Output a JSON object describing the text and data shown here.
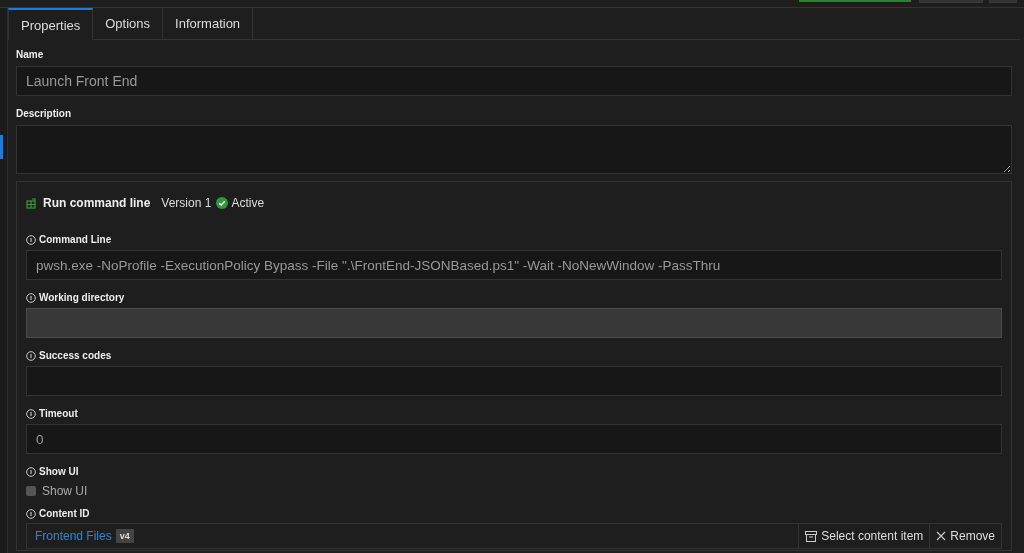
{
  "tabs": [
    {
      "label": "Properties",
      "selected": true
    },
    {
      "label": "Options",
      "selected": false
    },
    {
      "label": "Information",
      "selected": false
    }
  ],
  "name": {
    "label": "Name",
    "value": "Launch Front End"
  },
  "description": {
    "label": "Description"
  },
  "step": {
    "title": "Run command line",
    "version": "Version 1",
    "status": "Active",
    "active": true,
    "fields": [
      {
        "kind": "text",
        "label": "Command Line",
        "value": "pwsh.exe -NoProfile -ExecutionPolicy Bypass -File \".\\FrontEnd-JSONBased.ps1\" -Wait -NoNewWindow -PassThru",
        "disabled": false
      },
      {
        "kind": "text",
        "label": "Working directory",
        "disabled": true
      },
      {
        "kind": "text",
        "label": "Success codes",
        "disabled": false
      },
      {
        "kind": "text",
        "label": "Timeout",
        "value": "0",
        "disabled": false
      },
      {
        "kind": "checkbox",
        "label": "Show UI",
        "option": "Show UI",
        "checked": false
      },
      {
        "kind": "content",
        "label": "Content ID",
        "link": "Frontend Files",
        "badge": "v4",
        "select": "Select content item",
        "remove": "Remove"
      }
    ]
  }
}
